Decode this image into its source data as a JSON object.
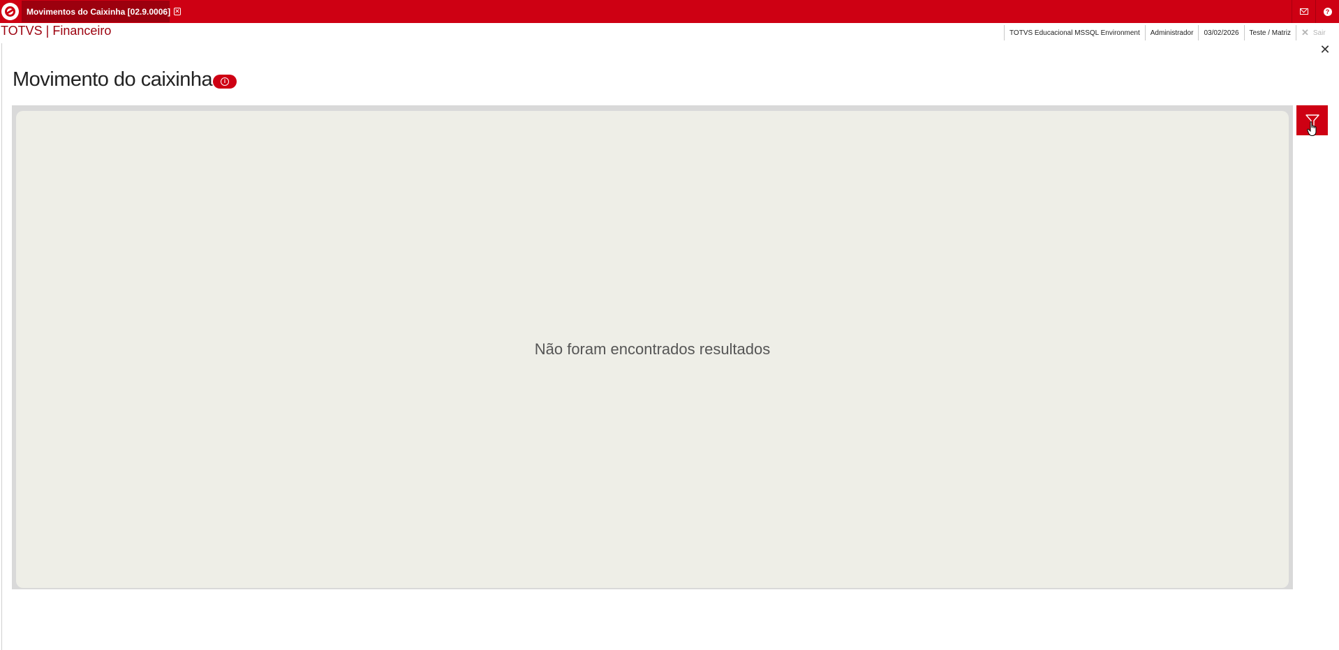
{
  "topbar": {
    "tab_title": "Movimentos do Caixinha [02.9.0006]",
    "tab_close_glyph": "✕",
    "logo_icon": "totvs-logo-icon",
    "mail_icon": "mail-icon",
    "help_icon": "help-icon",
    "help_glyph": "?"
  },
  "header": {
    "brand": "TOTVS | Financeiro",
    "status": {
      "environment": "TOTVS Educacional MSSQL Environment",
      "user": "Administrador",
      "date": "03/02/2026",
      "company": "Teste / Matriz",
      "exit_label": "Sair"
    }
  },
  "page": {
    "title": "Movimento do caixinha",
    "info_glyph": "i",
    "close_glyph": "✕",
    "empty_message": "Não foram encontrados resultados"
  },
  "colors": {
    "brand_red": "#ce0013",
    "dark_red": "#9c000e",
    "panel_bg": "#eeeee7",
    "panel_border": "#d9d9d9"
  }
}
